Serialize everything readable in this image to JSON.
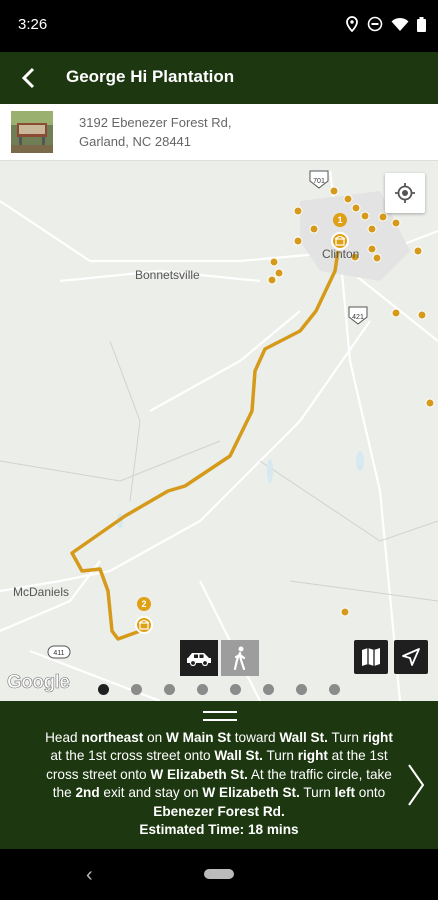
{
  "status": {
    "time": "3:26"
  },
  "header": {
    "title": "George Hi Plantation"
  },
  "address": {
    "line1": "3192 Ebenezer Forest Rd,",
    "line2": "Garland, NC 28441"
  },
  "map": {
    "labels": {
      "bonnetsville": "Bonnetsville",
      "mcdaniels": "McDaniels",
      "clinton": "Clinton",
      "hwy701": "701",
      "hwy421": "421",
      "hwy411": "411"
    },
    "markers": {
      "start": "1",
      "end": "2"
    },
    "google": "Google",
    "route_color": "#d69a1a"
  },
  "pager": {
    "count": 8,
    "active": 0
  },
  "directions": {
    "t1": "Head ",
    "b1": "northeast",
    "t2": " on ",
    "b2": "W Main St",
    "t3": " toward ",
    "b3": "Wall St.",
    "t4": " Turn ",
    "b4": "right",
    "t5": " at the 1st cross street onto ",
    "b5": "Wall St.",
    "t6": " Turn ",
    "b6": "right",
    "t7": " at the 1st cross street onto ",
    "b7": "W Elizabeth St.",
    "t8": " At the traffic circle, take the ",
    "b8": "2nd",
    "t9": " exit and stay on ",
    "b9": "W Elizabeth St.",
    "t10": " Turn ",
    "b10": "left",
    "t11": " onto ",
    "b11": "Ebenezer Forest Rd.",
    "b12": "Estimated Time: 18 mins"
  }
}
